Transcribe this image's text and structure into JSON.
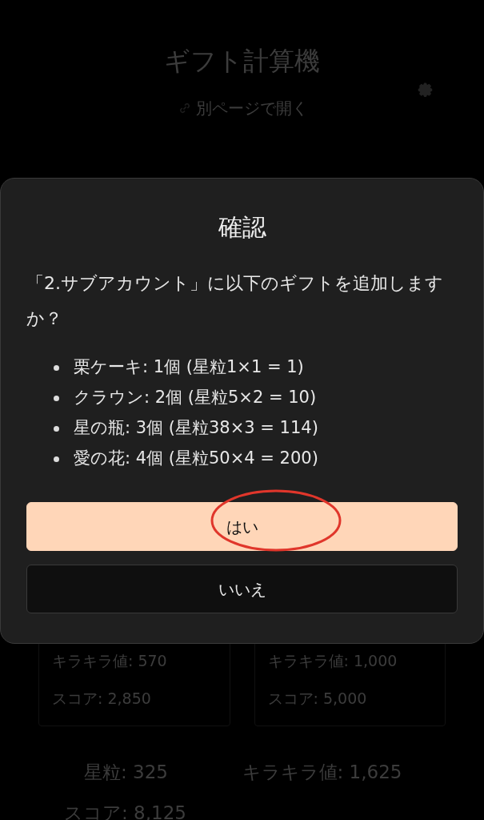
{
  "background": {
    "title": "ギフト計算機",
    "link": "別ページで開く",
    "cards": [
      {
        "sparkle": "キラキラ値: 570",
        "score": "スコア: 2,850"
      },
      {
        "sparkle": "キラキラ値: 1,000",
        "score": "スコア: 5,000"
      }
    ],
    "totals": {
      "stardust": "星粒: 325",
      "sparkle": "キラキラ値: 1,625",
      "score": "スコア: 8,125"
    }
  },
  "dialog": {
    "title": "確認",
    "message": "「2.サブアカウント」に以下のギフトを追加しますか？",
    "items": [
      "栗ケーキ: 1個 (星粒1×1 = 1)",
      "クラウン: 2個 (星粒5×2 = 10)",
      "星の瓶: 3個 (星粒38×3 = 114)",
      "愛の花: 4個 (星粒50×4 = 200)"
    ],
    "buttons": [
      {
        "label": "はい",
        "kind": "primary",
        "circled": true
      },
      {
        "label": "いいえ",
        "kind": "secondary",
        "circled": false
      }
    ]
  }
}
